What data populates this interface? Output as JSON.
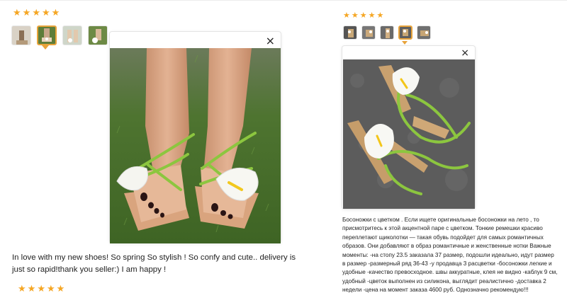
{
  "left_review": {
    "stars": [
      "★",
      "★",
      "★",
      "★",
      "★"
    ],
    "text": "In love with my new shoes! So spring So stylish ! So confy and cute.. delivery is just so rapid!thank you seller:) I am happy !",
    "next_stars": [
      "★",
      "★",
      "★",
      "★",
      "★"
    ]
  },
  "right_review": {
    "stars": [
      "★",
      "★",
      "★",
      "★",
      "★"
    ],
    "text": "Босоножки с цветком . Если ищете оригинальные босоножки на лето , то присмотритесь к этой акцентной паре с цветком. Тонкие ремешки красиво переплетают щиколотки — такая обувь подойдет для самых романтичных образов. Они добавляют в образ романтичные и женственные нотки Важные моменты: -на стопу 23.5 заказала 37 размер, подошли идеально, идут размер в размер -размерный ряд 36-43 -у продавца 3 расцветки -босоножки легкие и удобные -качество превосходное. швы аккуратные, клея не видно -каблук 9 см, удобный -цветок выполнен из силикона, выглядит реалистично -доставка 2 недели -цена на момент заказа 4600 руб. Однозначно рекомендую!!!"
  },
  "close_glyph": "×",
  "colors": {
    "star": "#f5a623",
    "active_thumb": "#e8a33a",
    "grass": "#4f7a2e",
    "strap": "#8cc63f",
    "carpet": "#5a5a5a"
  }
}
